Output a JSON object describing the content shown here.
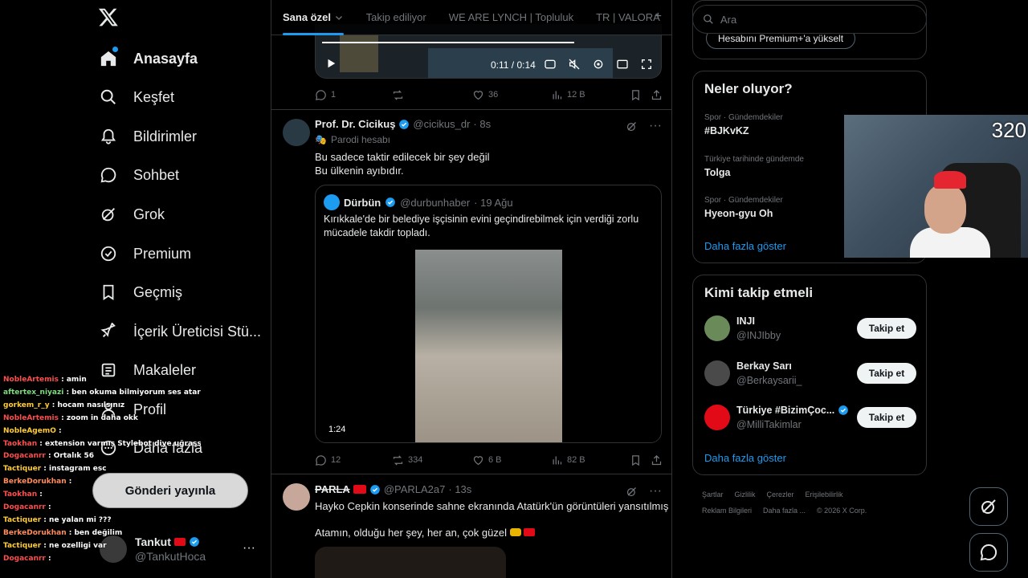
{
  "nav": {
    "items": [
      {
        "label": "Anasayfa",
        "icon": "home-icon"
      },
      {
        "label": "Keşfet",
        "icon": "search-icon"
      },
      {
        "label": "Bildirimler",
        "icon": "bell-icon"
      },
      {
        "label": "Sohbet",
        "icon": "chat-icon"
      },
      {
        "label": "Grok",
        "icon": "grok-icon"
      },
      {
        "label": "Premium",
        "icon": "verified-icon"
      },
      {
        "label": "Geçmiş",
        "icon": "bookmark-icon"
      },
      {
        "label": "İçerik Üreticisi Stü...",
        "icon": "rocket-icon"
      },
      {
        "label": "Makaleler",
        "icon": "article-icon"
      },
      {
        "label": "Profil",
        "icon": "person-icon"
      },
      {
        "label": "Daha fazla",
        "icon": "more-circle-icon"
      }
    ],
    "post_button": "Gönderi yayınla",
    "account": {
      "name": "Tankut",
      "handle": "@TankutHoca"
    }
  },
  "chat": [
    {
      "user": "NobleArtemis",
      "color": "#ff4d4d",
      "msg": ": amin"
    },
    {
      "user": "aftertex_niyazi",
      "color": "#7ddc7d",
      "msg": ": ben okuma bilmiyorum ses atarmısınız"
    },
    {
      "user": "gorkem_r_y",
      "color": "#ffcc33",
      "msg": ": hocam nasılsınız"
    },
    {
      "user": "NobleArtemis",
      "color": "#ff4d4d",
      "msg": ": zoom in daha okk"
    },
    {
      "user": "NobleAgemO",
      "color": "#ffcc33",
      "msg": ":"
    },
    {
      "user": "Taokhan",
      "color": "#ff4d4d",
      "msg": ": extension varmış Stylebot diye uğraşsaın olursa"
    },
    {
      "user": "Dogacanrr",
      "color": "#ff4d4d",
      "msg": ": Ortalık 56"
    },
    {
      "user": "Tactiquer",
      "color": "#ffcc33",
      "msg": ": instagram esc"
    },
    {
      "user": "BerkeDorukhan",
      "color": "#ff8c5a",
      "msg": ":"
    },
    {
      "user": "Taokhan",
      "color": "#ff4d4d",
      "msg": ":"
    },
    {
      "user": "Dogacanrr",
      "color": "#ff4d4d",
      "msg": ":"
    },
    {
      "user": "Tactiquer",
      "color": "#ffcc33",
      "msg": ": ne yalan mi ???"
    },
    {
      "user": "BerkeDorukhan",
      "color": "#ff8c5a",
      "msg": ": ben değilim"
    },
    {
      "user": "Tactiquer",
      "color": "#ffcc33",
      "msg": ": ne ozelligi var"
    },
    {
      "user": "Dogacanrr",
      "color": "#ff4d4d",
      "msg": ":"
    }
  ],
  "tabs": [
    "Sana özel",
    "Takip ediliyor",
    "WE ARE LYNCH | Topluluk",
    "TR | VALORA"
  ],
  "tweet1": {
    "video_time": "0:11 / 0:14",
    "replies": "1",
    "likes": "36",
    "views": "12 B"
  },
  "tweet2": {
    "name": "Prof. Dr. Cicikuş",
    "handle": "@cicikus_dr",
    "time": "· 8s",
    "parody": "Parodi hesabı",
    "text_line1": "Bu sadece taktir edilecek bir şey değil",
    "text_line2": "Bu ülkenin ayıbıdır.",
    "quote": {
      "name": "Dürbün",
      "handle": "@durbunhaber",
      "time": "· 19 Ağu",
      "text": "Kırıkkale'de bir belediye işçisinin evini geçindirebilmek için verdiği zorlu mücadele takdir topladı.",
      "duration": "1:24"
    },
    "replies": "12",
    "retweets": "334",
    "likes": "6 B",
    "views": "82 B"
  },
  "tweet3": {
    "name": "PARLA",
    "handle": "@PARLA2a7",
    "time": "· 13s",
    "text_line1": "Hayko Cepkin konserinde sahne ekranında Atatürk'ün görüntüleri yansıtılmış",
    "text_line2": "Atamın, olduğu her şey, her an, çok güzel"
  },
  "right": {
    "search_placeholder": "Ara",
    "premium_button": "Hesabını Premium+'a yükselt",
    "trends_title": "Neler oluyor?",
    "trends": [
      {
        "category": "Spor · Gündemdekiler",
        "topic": "#BJKvKZ"
      },
      {
        "category": "Türkiye tarihinde gündemde",
        "topic": "Tolga"
      },
      {
        "category": "Spor · Gündemdekiler",
        "topic": "Hyeon-gyu Oh"
      }
    ],
    "show_more": "Daha fazla göster",
    "follow_title": "Kimi takip etmeli",
    "follow": [
      {
        "name": "INJI",
        "handle": "@INJIbby",
        "verified": false
      },
      {
        "name": "Berkay Sarı",
        "handle": "@Berkaysarii_",
        "verified": false
      },
      {
        "name": "Türkiye #BizimÇoc...",
        "handle": "@MilliTakimlar",
        "verified": true
      }
    ],
    "follow_button": "Takip et",
    "footer1": [
      "Şartlar",
      "Gizlilik",
      "Çerezler",
      "Erişilebilirlik"
    ],
    "footer2": [
      "Reklam Bilgileri",
      "Daha fazla ...",
      "© 2026 X Corp."
    ]
  },
  "cam": {
    "count": "320"
  },
  "colors": {
    "accent": "#1d9bf0",
    "bg": "#000000",
    "border": "#2f3336"
  }
}
